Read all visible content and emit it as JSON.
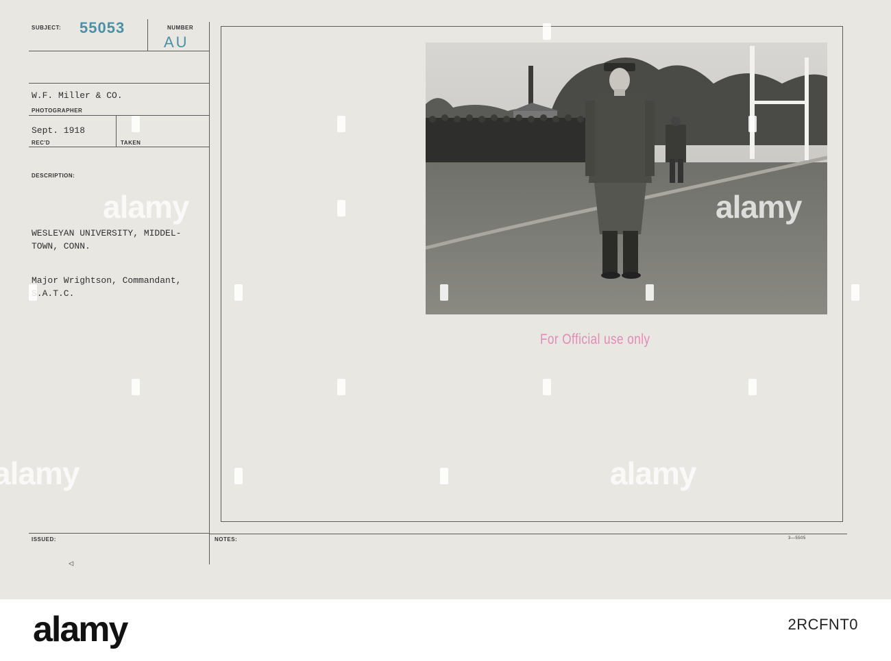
{
  "card": {
    "subject_label": "SUBJECT:",
    "subject_number": "55053",
    "number_label": "NUMBER",
    "number_value": "AU",
    "photographer_name": "W.F. Miller & CO.",
    "photographer_label": "PHOTOGRAPHER",
    "recd_date": "Sept. 1918",
    "recd_label": "REC'D",
    "taken_label": "TAKEN",
    "description_label": "DESCRIPTION:",
    "description_line1": "WESLEYAN UNIVERSITY, MIDDEL-",
    "description_line2": "TOWN, CONN.",
    "description_line3": "Major Wrightson, Commandant,",
    "description_line4": "S.A.T.C.",
    "issued_label": "ISSUED:",
    "notes_label": "NOTES:",
    "form_number": "3—5505",
    "official_stamp": "For Official use only",
    "issued_mark": "◁"
  },
  "watermark": {
    "text": "alamy"
  },
  "footer": {
    "brand": "alamy",
    "image_id": "2RCFNT0"
  },
  "colors": {
    "card_bg": "#e9e7e2",
    "stamp_blue": "#4a90a6",
    "stamp_pink": "#e38bb8"
  }
}
